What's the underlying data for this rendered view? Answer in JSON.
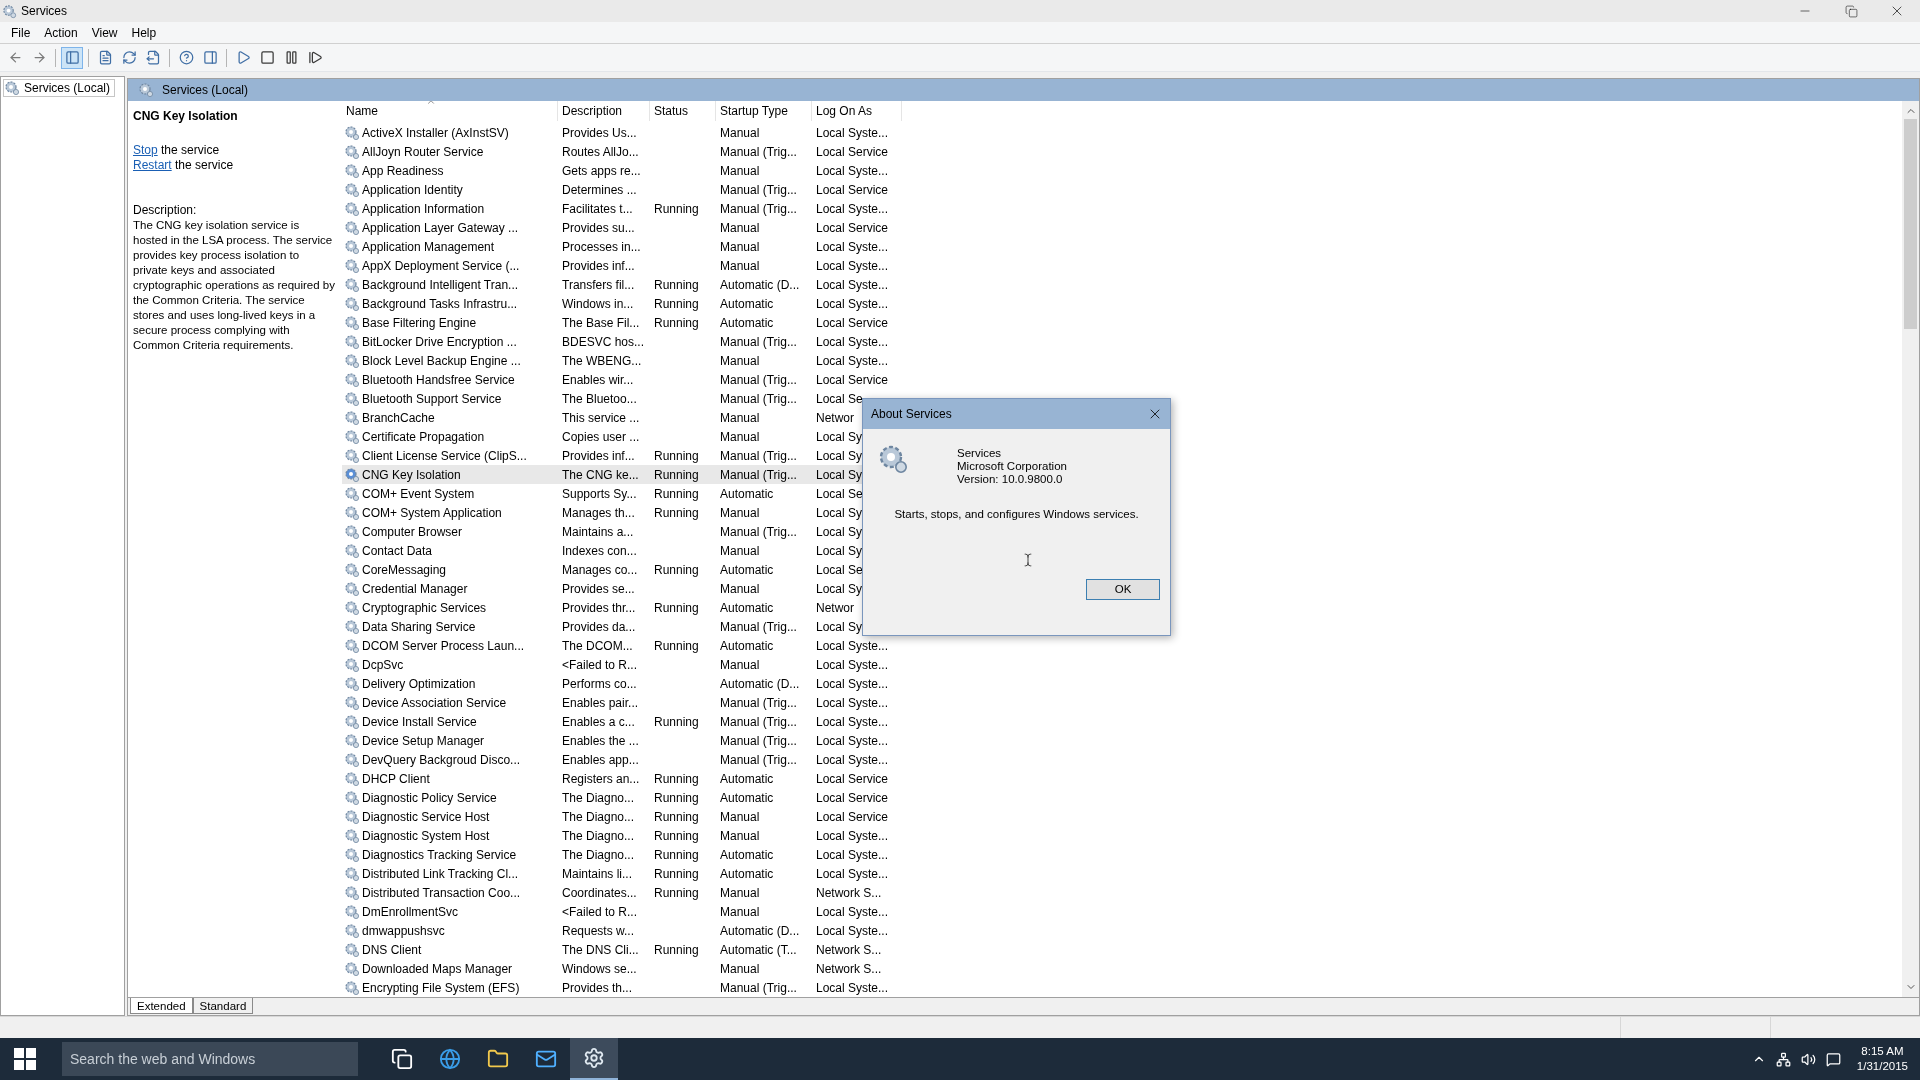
{
  "window": {
    "title": "Services"
  },
  "menu": [
    "File",
    "Action",
    "View",
    "Help"
  ],
  "toolbar": {
    "console_tree_pressed": true
  },
  "tree": [
    {
      "label": "Services (Local)",
      "selected": true
    }
  ],
  "panel": {
    "title": "Services (Local)"
  },
  "details": {
    "service_name": "CNG Key Isolation",
    "actions": [
      {
        "link": "Stop",
        "text": "the service"
      },
      {
        "link": "Restart",
        "text": "the service"
      }
    ],
    "description_label": "Description:",
    "description": "The CNG key isolation service is hosted in the LSA process. The service provides key process isolation to private keys and associated cryptographic operations as required by the Common Criteria. The service stores and uses long-lived keys in a secure process complying with Common Criteria requirements."
  },
  "table": {
    "columns": [
      {
        "label": "Name",
        "sorted": true
      },
      {
        "label": "Description",
        "sorted": false
      },
      {
        "label": "Status",
        "sorted": false
      },
      {
        "label": "Startup Type",
        "sorted": false
      },
      {
        "label": "Log On As",
        "sorted": false
      }
    ],
    "rows": [
      {
        "name": "ActiveX Installer (AxInstSV)",
        "description": "Provides Us...",
        "startup_type": "Manual",
        "log_on_as": "Local Syste...",
        "selected": false
      },
      {
        "name": "AllJoyn Router Service",
        "description": "Routes AllJo...",
        "startup_type": "Manual (Trig...",
        "log_on_as": "Local Service",
        "selected": false
      },
      {
        "name": "App Readiness",
        "description": "Gets apps re...",
        "startup_type": "Manual",
        "log_on_as": "Local Syste...",
        "selected": false
      },
      {
        "name": "Application Identity",
        "description": "Determines ...",
        "startup_type": "Manual (Trig...",
        "log_on_as": "Local Service",
        "selected": false
      },
      {
        "name": "Application Information",
        "description": "Facilitates t...",
        "status": "Running",
        "startup_type": "Manual (Trig...",
        "log_on_as": "Local Syste...",
        "selected": false
      },
      {
        "name": "Application Layer Gateway ...",
        "description": "Provides su...",
        "startup_type": "Manual",
        "log_on_as": "Local Service",
        "selected": false
      },
      {
        "name": "Application Management",
        "description": "Processes in...",
        "startup_type": "Manual",
        "log_on_as": "Local Syste...",
        "selected": false
      },
      {
        "name": "AppX Deployment Service (...",
        "description": "Provides inf...",
        "startup_type": "Manual",
        "log_on_as": "Local Syste...",
        "selected": false
      },
      {
        "name": "Background Intelligent Tran...",
        "description": "Transfers fil...",
        "status": "Running",
        "startup_type": "Automatic (D...",
        "log_on_as": "Local Syste...",
        "selected": false
      },
      {
        "name": "Background Tasks Infrastru...",
        "description": "Windows in...",
        "status": "Running",
        "startup_type": "Automatic",
        "log_on_as": "Local Syste...",
        "selected": false
      },
      {
        "name": "Base Filtering Engine",
        "description": "The Base Fil...",
        "status": "Running",
        "startup_type": "Automatic",
        "log_on_as": "Local Service",
        "selected": false
      },
      {
        "name": "BitLocker Drive Encryption ...",
        "description": "BDESVC hos...",
        "startup_type": "Manual (Trig...",
        "log_on_as": "Local Syste...",
        "selected": false
      },
      {
        "name": "Block Level Backup Engine ...",
        "description": "The WBENG...",
        "startup_type": "Manual",
        "log_on_as": "Local Syste...",
        "selected": false
      },
      {
        "name": "Bluetooth Handsfree Service",
        "description": "Enables wir...",
        "startup_type": "Manual (Trig...",
        "log_on_as": "Local Service",
        "selected": false
      },
      {
        "name": "Bluetooth Support Service",
        "description": "The Bluetoo...",
        "startup_type": "Manual (Trig...",
        "log_on_as": "Local Se",
        "selected": false
      },
      {
        "name": "BranchCache",
        "description": "This service ...",
        "startup_type": "Manual",
        "log_on_as": "Networ",
        "selected": false
      },
      {
        "name": "Certificate Propagation",
        "description": "Copies user ...",
        "startup_type": "Manual",
        "log_on_as": "Local Sy",
        "selected": false
      },
      {
        "name": "Client License Service (ClipS...",
        "description": "Provides inf...",
        "status": "Running",
        "startup_type": "Manual (Trig...",
        "log_on_as": "Local Sy",
        "selected": false
      },
      {
        "name": "CNG Key Isolation",
        "description": "The CNG ke...",
        "status": "Running",
        "startup_type": "Manual (Trig...",
        "log_on_as": "Local Sy",
        "selected": true
      },
      {
        "name": "COM+ Event System",
        "description": "Supports Sy...",
        "status": "Running",
        "startup_type": "Automatic",
        "log_on_as": "Local Se",
        "selected": false
      },
      {
        "name": "COM+ System Application",
        "description": "Manages th...",
        "status": "Running",
        "startup_type": "Manual",
        "log_on_as": "Local Sy",
        "selected": false
      },
      {
        "name": "Computer Browser",
        "description": "Maintains a...",
        "startup_type": "Manual (Trig...",
        "log_on_as": "Local Sy",
        "selected": false
      },
      {
        "name": "Contact Data",
        "description": "Indexes con...",
        "startup_type": "Manual",
        "log_on_as": "Local Sy",
        "selected": false
      },
      {
        "name": "CoreMessaging",
        "description": "Manages co...",
        "status": "Running",
        "startup_type": "Automatic",
        "log_on_as": "Local Se",
        "selected": false
      },
      {
        "name": "Credential Manager",
        "description": "Provides se...",
        "startup_type": "Manual",
        "log_on_as": "Local Sy",
        "selected": false
      },
      {
        "name": "Cryptographic Services",
        "description": "Provides thr...",
        "status": "Running",
        "startup_type": "Automatic",
        "log_on_as": "Networ",
        "selected": false
      },
      {
        "name": "Data Sharing Service",
        "description": "Provides da...",
        "startup_type": "Manual (Trig...",
        "log_on_as": "Local Sy",
        "selected": false
      },
      {
        "name": "DCOM Server Process Laun...",
        "description": "The DCOM...",
        "status": "Running",
        "startup_type": "Automatic",
        "log_on_as": "Local Syste...",
        "selected": false
      },
      {
        "name": "DcpSvc",
        "description": "<Failed to R...",
        "startup_type": "Manual",
        "log_on_as": "Local Syste...",
        "selected": false
      },
      {
        "name": "Delivery Optimization",
        "description": "Performs co...",
        "startup_type": "Automatic (D...",
        "log_on_as": "Local Syste...",
        "selected": false
      },
      {
        "name": "Device Association Service",
        "description": "Enables pair...",
        "startup_type": "Manual (Trig...",
        "log_on_as": "Local Syste...",
        "selected": false
      },
      {
        "name": "Device Install Service",
        "description": "Enables a c...",
        "status": "Running",
        "startup_type": "Manual (Trig...",
        "log_on_as": "Local Syste...",
        "selected": false
      },
      {
        "name": "Device Setup Manager",
        "description": "Enables the ...",
        "startup_type": "Manual (Trig...",
        "log_on_as": "Local Syste...",
        "selected": false
      },
      {
        "name": "DevQuery Backgroud Disco...",
        "description": "Enables app...",
        "startup_type": "Manual (Trig...",
        "log_on_as": "Local Syste...",
        "selected": false
      },
      {
        "name": "DHCP Client",
        "description": "Registers an...",
        "status": "Running",
        "startup_type": "Automatic",
        "log_on_as": "Local Service",
        "selected": false
      },
      {
        "name": "Diagnostic Policy Service",
        "description": "The Diagno...",
        "status": "Running",
        "startup_type": "Automatic",
        "log_on_as": "Local Service",
        "selected": false
      },
      {
        "name": "Diagnostic Service Host",
        "description": "The Diagno...",
        "status": "Running",
        "startup_type": "Manual",
        "log_on_as": "Local Service",
        "selected": false
      },
      {
        "name": "Diagnostic System Host",
        "description": "The Diagno...",
        "status": "Running",
        "startup_type": "Manual",
        "log_on_as": "Local Syste...",
        "selected": false
      },
      {
        "name": "Diagnostics Tracking Service",
        "description": "The Diagno...",
        "status": "Running",
        "startup_type": "Automatic",
        "log_on_as": "Local Syste...",
        "selected": false
      },
      {
        "name": "Distributed Link Tracking Cl...",
        "description": "Maintains li...",
        "status": "Running",
        "startup_type": "Automatic",
        "log_on_as": "Local Syste...",
        "selected": false
      },
      {
        "name": "Distributed Transaction Coo...",
        "description": "Coordinates...",
        "status": "Running",
        "startup_type": "Manual",
        "log_on_as": "Network S...",
        "selected": false
      },
      {
        "name": "DmEnrollmentSvc",
        "description": "<Failed to R...",
        "startup_type": "Manual",
        "log_on_as": "Local Syste...",
        "selected": false
      },
      {
        "name": "dmwappushsvc",
        "description": "Requests w...",
        "startup_type": "Automatic (D...",
        "log_on_as": "Local Syste...",
        "selected": false
      },
      {
        "name": "DNS Client",
        "description": "The DNS Cli...",
        "status": "Running",
        "startup_type": "Automatic (T...",
        "log_on_as": "Network S...",
        "selected": false
      },
      {
        "name": "Downloaded Maps Manager",
        "description": "Windows se...",
        "startup_type": "Manual",
        "log_on_as": "Network S...",
        "selected": false
      },
      {
        "name": "Encrypting File System (EFS)",
        "description": "Provides th...",
        "startup_type": "Manual (Trig...",
        "log_on_as": "Local Syste...",
        "selected": false
      }
    ]
  },
  "view_tabs": [
    {
      "label": "Extended",
      "selected": true
    },
    {
      "label": "Standard",
      "selected": false
    }
  ],
  "dialog": {
    "title": "About Services",
    "product": "Services",
    "company": "Microsoft Corporation",
    "version": "Version: 10.0.9800.0",
    "summary": "Starts, stops, and configures Windows services.",
    "button": "OK"
  },
  "taskbar": {
    "search": {
      "placeholder": "Search the web and Windows"
    },
    "apps": [
      {
        "kind": "task-view",
        "active": false
      },
      {
        "kind": "browser",
        "active": false
      },
      {
        "kind": "folder",
        "active": false
      },
      {
        "kind": "mail",
        "active": false
      },
      {
        "kind": "services",
        "active": true
      }
    ],
    "clock": {
      "time": "8:15 AM",
      "date": "1/31/2015"
    }
  }
}
